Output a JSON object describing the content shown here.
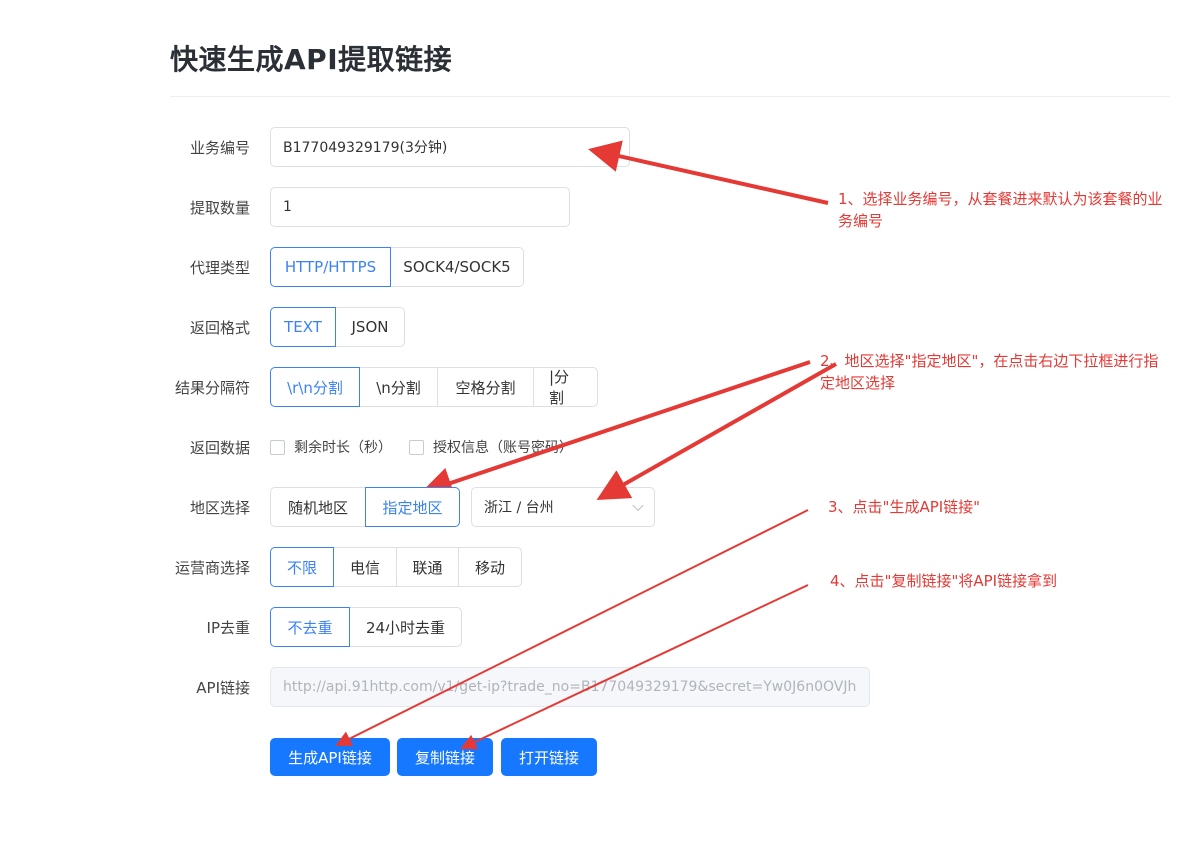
{
  "page": {
    "title": "快速生成API提取链接"
  },
  "form": {
    "business_no": {
      "label": "业务编号",
      "value": "B177049329179(3分钟)"
    },
    "quantity": {
      "label": "提取数量",
      "value": "1"
    },
    "proxy_type": {
      "label": "代理类型",
      "options": [
        "HTTP/HTTPS",
        "SOCK4/SOCK5"
      ],
      "selected": "HTTP/HTTPS"
    },
    "format": {
      "label": "返回格式",
      "options": [
        "TEXT",
        "JSON"
      ],
      "selected": "TEXT"
    },
    "separator": {
      "label": "结果分隔符",
      "options": [
        "\\r\\n分割",
        "\\n分割",
        "空格分割",
        "|分割"
      ],
      "selected": "\\r\\n分割"
    },
    "return_data": {
      "label": "返回数据",
      "options": [
        "剩余时长（秒）",
        "授权信息（账号密码）"
      ]
    },
    "region": {
      "label": "地区选择",
      "options": [
        "随机地区",
        "指定地区"
      ],
      "selected": "指定地区",
      "select_value": "浙江 / 台州"
    },
    "carrier": {
      "label": "运营商选择",
      "options": [
        "不限",
        "电信",
        "联通",
        "移动"
      ],
      "selected": "不限"
    },
    "dedup": {
      "label": "IP去重",
      "options": [
        "不去重",
        "24小时去重"
      ],
      "selected": "不去重"
    },
    "api_link": {
      "label": "API链接",
      "value": "http://api.91http.com/v1/get-ip?trade_no=B177049329179&secret=Yw0J6n0OVJh"
    }
  },
  "buttons": {
    "generate": "生成API链接",
    "copy": "复制链接",
    "open": "打开链接"
  },
  "annotations": {
    "a1": [
      "1、选择业务编号，从套餐进来默认为该套餐的业",
      "务编号"
    ],
    "a2": [
      "2、地区选择\"指定地区\"，在点击右边下拉框进行指",
      "定地区选择"
    ],
    "a3": "3、点击\"生成API链接\"",
    "a4": "4、点击\"复制链接\"将API链接拿到"
  },
  "colors": {
    "primary": "#1677ff",
    "active_border": "#3a82f6",
    "annotation": "#e53935"
  }
}
